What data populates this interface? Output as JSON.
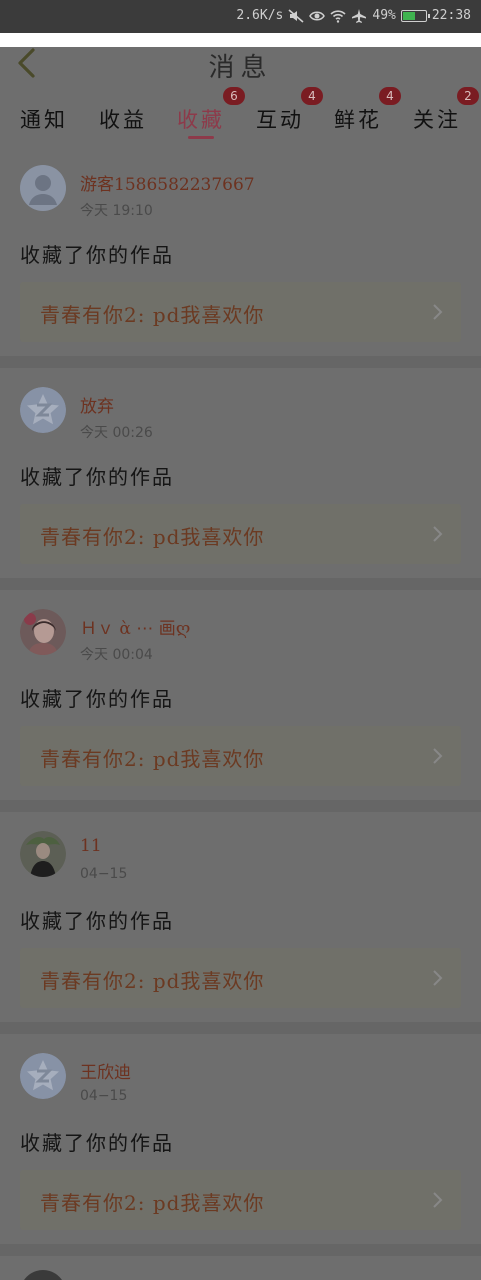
{
  "status_bar": {
    "speed": "2.6K/s",
    "battery_percent": "49%",
    "time": "22:38",
    "battery_level": 0.49,
    "battery_color": "#3fb34f"
  },
  "header": {
    "title": "消息"
  },
  "tabs": [
    {
      "label": "通知",
      "badge": ""
    },
    {
      "label": "收益",
      "badge": ""
    },
    {
      "label": "收藏",
      "badge": "6",
      "active": true
    },
    {
      "label": "互动",
      "badge": "4"
    },
    {
      "label": "鲜花",
      "badge": "4"
    },
    {
      "label": "关注",
      "badge": "2"
    }
  ],
  "notifications": [
    {
      "user": "游客1586582237667",
      "time": "今天  19:10",
      "action": "收藏了你的作品",
      "work": "青春有你2: pd我喜欢你",
      "avatar": "default-user-icon"
    },
    {
      "user": "放弃",
      "time": "今天  00:26",
      "action": "收藏了你的作品",
      "work": "青春有你2: pd我喜欢你",
      "avatar": "z-logo-icon"
    },
    {
      "user": "Ｈｖ ὰ ⋯ 画ღ",
      "time": "今天  00:04",
      "action": "收藏了你的作品",
      "work": "青春有你2: pd我喜欢你",
      "avatar": "photo-girl-avatar"
    },
    {
      "user": "11",
      "time": "04−15",
      "action": "收藏了你的作品",
      "work": "青春有你2: pd我喜欢你",
      "avatar": "photo-person-avatar"
    },
    {
      "user": "王欣迪",
      "time": "04−15",
      "action": "收藏了你的作品",
      "work": "青春有你2: pd我喜欢你",
      "avatar": "z-logo-icon"
    }
  ],
  "colors": {
    "accent": "#8d3a4a",
    "badge": "#7a1c22",
    "username": "#6d3220"
  }
}
